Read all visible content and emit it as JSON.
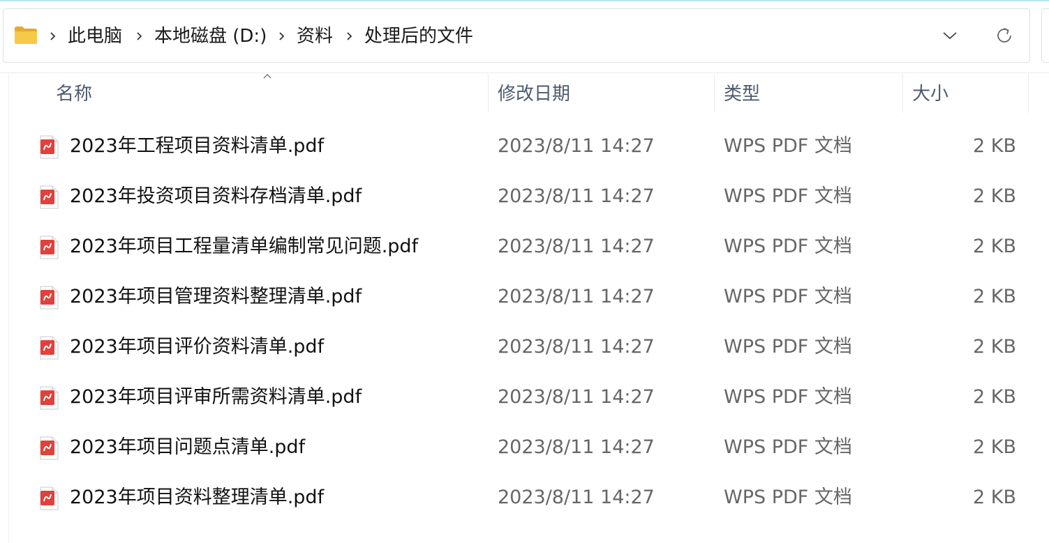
{
  "address_bar": {
    "breadcrumbs": [
      "此电脑",
      "本地磁盘 (D:)",
      "资料",
      "处理后的文件"
    ]
  },
  "columns": {
    "name": "名称",
    "modified": "修改日期",
    "type": "类型",
    "size": "大小"
  },
  "files": [
    {
      "name": "2023年工程项目资料清单.pdf",
      "modified": "2023/8/11 14:27",
      "type": "WPS PDF 文档",
      "size": "2 KB"
    },
    {
      "name": "2023年投资项目资料存档清单.pdf",
      "modified": "2023/8/11 14:27",
      "type": "WPS PDF 文档",
      "size": "2 KB"
    },
    {
      "name": "2023年项目工程量清单编制常见问题.pdf",
      "modified": "2023/8/11 14:27",
      "type": "WPS PDF 文档",
      "size": "2 KB"
    },
    {
      "name": "2023年项目管理资料整理清单.pdf",
      "modified": "2023/8/11 14:27",
      "type": "WPS PDF 文档",
      "size": "2 KB"
    },
    {
      "name": "2023年项目评价资料清单.pdf",
      "modified": "2023/8/11 14:27",
      "type": "WPS PDF 文档",
      "size": "2 KB"
    },
    {
      "name": "2023年项目评审所需资料清单.pdf",
      "modified": "2023/8/11 14:27",
      "type": "WPS PDF 文档",
      "size": "2 KB"
    },
    {
      "name": "2023年项目问题点清单.pdf",
      "modified": "2023/8/11 14:27",
      "type": "WPS PDF 文档",
      "size": "2 KB"
    },
    {
      "name": "2023年项目资料整理清单.pdf",
      "modified": "2023/8/11 14:27",
      "type": "WPS PDF 文档",
      "size": "2 KB"
    }
  ],
  "icons": {
    "folder": "folder-icon",
    "separator": "chevron-right-icon",
    "dropdown": "chevron-down-icon",
    "refresh": "refresh-icon",
    "file": "pdf-file-icon",
    "sort": "sort-ascending-icon"
  },
  "colors": {
    "folder_yellow": "#f5c242",
    "pdf_red": "#e2403a",
    "header_text": "#4d5b6e",
    "secondary_text": "#666666"
  }
}
